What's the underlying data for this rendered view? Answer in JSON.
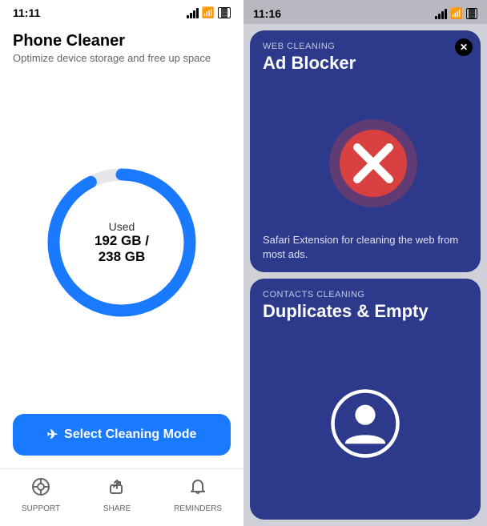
{
  "left": {
    "status_time": "11:11",
    "app_title": "Phone Cleaner",
    "app_subtitle": "Optimize device storage and free up space",
    "donut": {
      "label": "Used",
      "value": "192 GB / 238 GB",
      "used_gb": 192,
      "total_gb": 238,
      "progress_pct": 80.7
    },
    "select_btn_label": "Select Cleaning Mode",
    "nav": [
      {
        "id": "support",
        "label": "SUPPORT",
        "icon": "🎯"
      },
      {
        "id": "share",
        "label": "SHARE",
        "icon": "↗"
      },
      {
        "id": "reminders",
        "label": "REMINDERS",
        "icon": "🔔"
      }
    ]
  },
  "right": {
    "status_time": "11:16",
    "cards": [
      {
        "id": "web-cleaning",
        "category": "WEB CLEANING",
        "title": "Ad Blocker",
        "description": "Safari Extension for cleaning the web from most ads.",
        "has_close": true
      },
      {
        "id": "contacts-cleaning",
        "category": "CONTACTS CLEANING",
        "title": "Duplicates & Empty",
        "description": "",
        "has_close": false
      }
    ]
  }
}
